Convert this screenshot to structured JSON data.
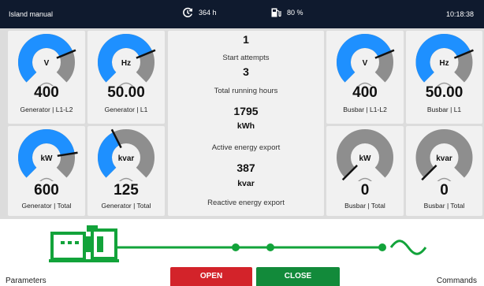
{
  "topbar": {
    "mode": "Island manual",
    "running_hours": "364 h",
    "fuel_level": "80 %",
    "time": "10:18:38"
  },
  "gauges": {
    "gen_v": {
      "unit": "V",
      "value": "400",
      "caption": "Generator | L1-L2",
      "fill": 0.75
    },
    "gen_hz": {
      "unit": "Hz",
      "value": "50.00",
      "caption": "Generator | L1",
      "fill": 0.75
    },
    "gen_kw": {
      "unit": "kW",
      "value": "600",
      "caption": "Generator | Total",
      "fill": 0.8
    },
    "gen_kvar": {
      "unit": "kvar",
      "value": "125",
      "caption": "Generator | Total",
      "fill": 0.4
    },
    "bus_v": {
      "unit": "V",
      "value": "400",
      "caption": "Busbar | L1-L2",
      "fill": 0.75
    },
    "bus_hz": {
      "unit": "Hz",
      "value": "50.00",
      "caption": "Busbar | L1",
      "fill": 0.75
    },
    "bus_kw": {
      "unit": "kW",
      "value": "0",
      "caption": "Busbar | Total",
      "fill": 0.0
    },
    "bus_kvar": {
      "unit": "kvar",
      "value": "0",
      "caption": "Busbar | Total",
      "fill": 0.0
    }
  },
  "center": {
    "start_attempts_value": "1",
    "start_attempts_label": "Start attempts",
    "running_hours_value": "3",
    "running_hours_label": "Total running hours",
    "active_energy_value": "1795",
    "active_energy_unit": "kWh",
    "active_energy_label": "Active energy export",
    "reactive_energy_value": "387",
    "reactive_energy_unit": "kvar",
    "reactive_energy_label": "Reactive energy export"
  },
  "bottom": {
    "parameters_label": "Parameters",
    "commands_label": "Commands",
    "open_label": "OPEN",
    "close_label": "CLOSE"
  },
  "colors": {
    "active_arc": "#1e90ff",
    "inactive_arc": "#8e8e8e",
    "topbar_bg": "#0f1a2e",
    "genset_green": "#12a33a",
    "open_red": "#d3232a",
    "close_green": "#128a3a"
  }
}
